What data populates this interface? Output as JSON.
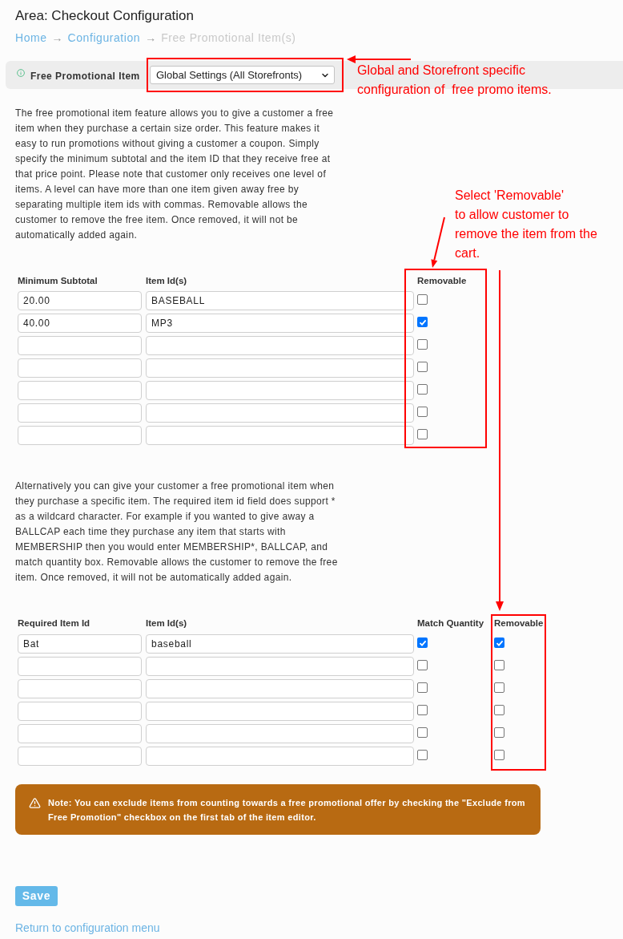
{
  "page": {
    "title": "Area: Checkout Configuration"
  },
  "breadcrumb": [
    {
      "label": "Home",
      "kind": "link"
    },
    {
      "separator": "→",
      "label": "Configuration",
      "kind": "link"
    },
    {
      "separator": "→",
      "label": "Free Promotional Item(s)",
      "kind": "current"
    }
  ],
  "scope_bar": {
    "label": "Free Promotional Item",
    "select_value": "Global Settings (All Storefronts)"
  },
  "intro_text": "The free promotional item feature allows you to give a customer a free item when they purchase a certain size order. This feature makes it easy to run promotions without giving a customer a coupon. Simply specify the minimum subtotal and the item ID that they receive free at that price point. Please note that customer only receives one level of items. A level can have more than one item given away free by separating multiple item ids with commas. Removable allows the customer to remove the free item. Once removed, it will not be automatically added again.",
  "subtotal_table": {
    "columns": [
      "Minimum Subtotal",
      "Item Id(s)",
      "Removable"
    ],
    "rows": [
      {
        "minimum_subtotal": "20.00",
        "item_ids": "BASEBALL",
        "removable": false
      },
      {
        "minimum_subtotal": "40.00",
        "item_ids": "MP3",
        "removable": true
      },
      {
        "removable": false
      },
      {
        "removable": false
      },
      {
        "removable": false
      },
      {
        "removable": false
      },
      {
        "removable": false
      }
    ]
  },
  "item_text": "Alternatively you can give your customer a free promotional item when they purchase a specific item. The required item id field does support * as a wildcard character. For example if you wanted to give away a BALLCAP each time they purchase any item that starts with MEMBERSHIP then you would enter MEMBERSHIP*, BALLCAP, and match quantity box. Removable allows the customer to remove the free item. Once removed, it will not be automatically added again.",
  "item_table": {
    "columns": [
      "Required Item Id",
      "Item Id(s)",
      "Match Quantity",
      "Removable"
    ],
    "rows": [
      {
        "required_item_id": "Bat",
        "item_ids": "baseball",
        "match_quantity": true,
        "removable": true
      },
      {
        "match_quantity": false,
        "removable": false
      },
      {
        "match_quantity": false,
        "removable": false
      },
      {
        "match_quantity": false,
        "removable": false
      },
      {
        "match_quantity": false,
        "removable": false
      },
      {
        "match_quantity": false,
        "removable": false
      }
    ]
  },
  "note": {
    "text": "Note: You can exclude items from counting towards a free promotional offer by checking the \"Exclude from Free Promotion\" checkbox on the first tab of the item editor."
  },
  "save_button": {
    "label": "Save"
  },
  "return_link": {
    "label": "Return to configuration menu"
  },
  "annotations": [
    {
      "lines": [
        "Global and Storefront specific",
        "configuration of  free promo items."
      ]
    },
    {
      "lines": [
        "Select 'Removable'",
        "to allow customer to",
        "remove the item from the",
        "cart."
      ]
    }
  ]
}
